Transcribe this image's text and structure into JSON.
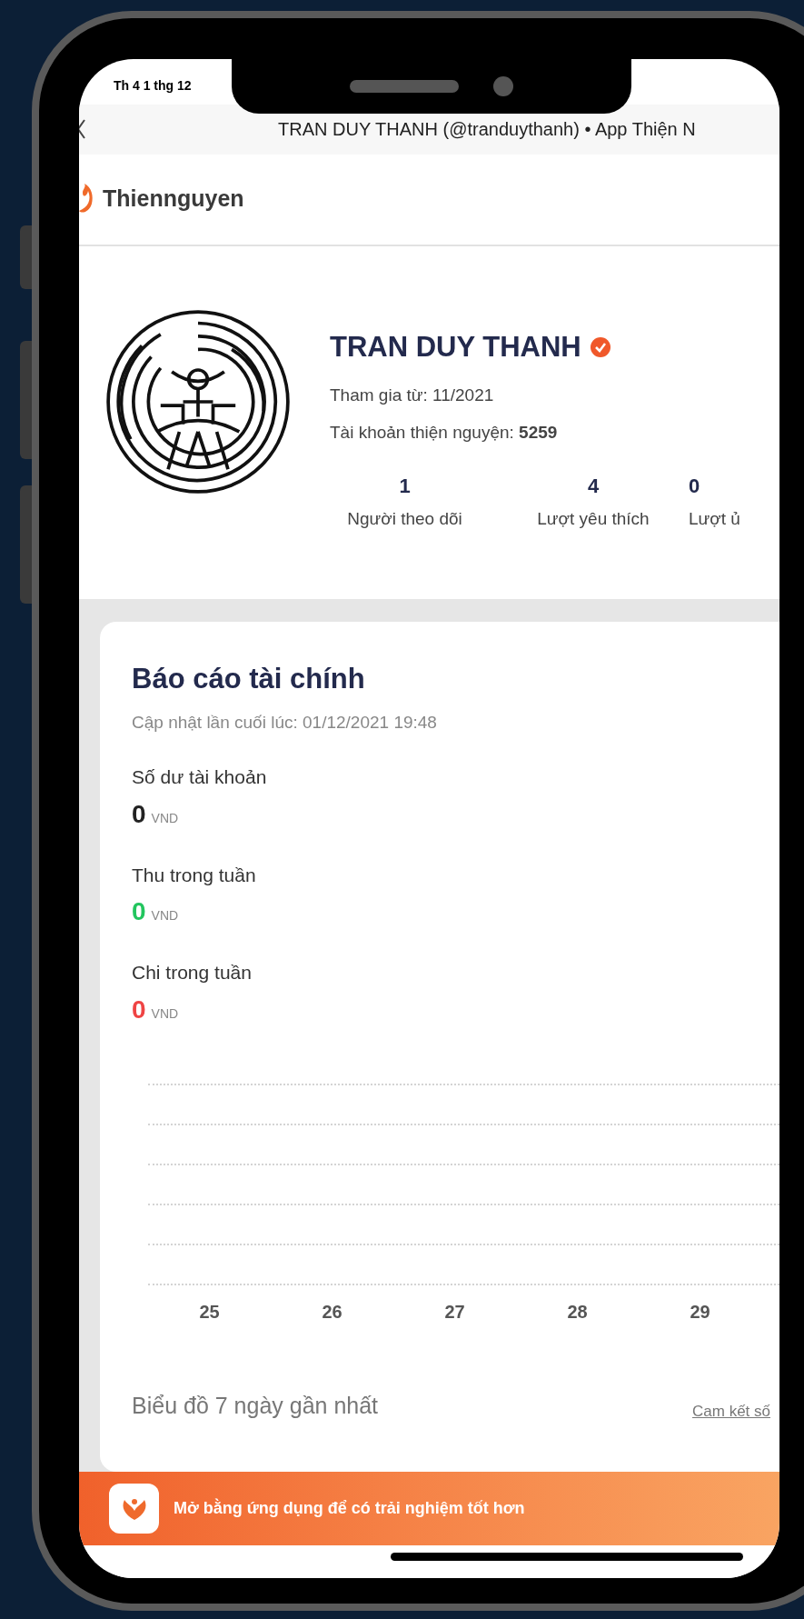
{
  "status_bar": {
    "date": "Th 4 1 thg 12"
  },
  "nav_bar": {
    "title": "TRAN DUY THANH (@tranduythanh) • App Thiện N"
  },
  "header": {
    "brand": "Thiennguyen"
  },
  "profile": {
    "name": "TRAN DUY THANH",
    "verified": true,
    "joined": "Tham gia từ: 11/2021",
    "account": "Tài khoản thiện nguyện: **5259**",
    "stats": [
      {
        "value": "1",
        "label": "Người theo dõi"
      },
      {
        "value": "4",
        "label": "Lượt yêu thích"
      },
      {
        "value": "0",
        "label": "Lượt ủ"
      }
    ]
  },
  "finance": {
    "title": "Báo cáo tài chính",
    "updated": "Cập nhật lần cuối lúc: 01/12/2021 19:48",
    "items": [
      {
        "label": "Số dư tài khoản",
        "amount": "0",
        "currency": "VND",
        "kind": "balance"
      },
      {
        "label": "Thu trong tuần",
        "amount": "0",
        "currency": "VND",
        "kind": "income"
      },
      {
        "label": "Chi trong tuần",
        "amount": "0",
        "currency": "VND",
        "kind": "expense"
      }
    ],
    "chart_x_labels": [
      "25",
      "26",
      "27",
      "28",
      "29"
    ],
    "caption": "Biểu đồ 7 ngày gần nhất",
    "link": "Cam kết số"
  },
  "banner": {
    "text": "Mở bằng ứng dụng để có trải nghiệm tốt hơn"
  }
}
